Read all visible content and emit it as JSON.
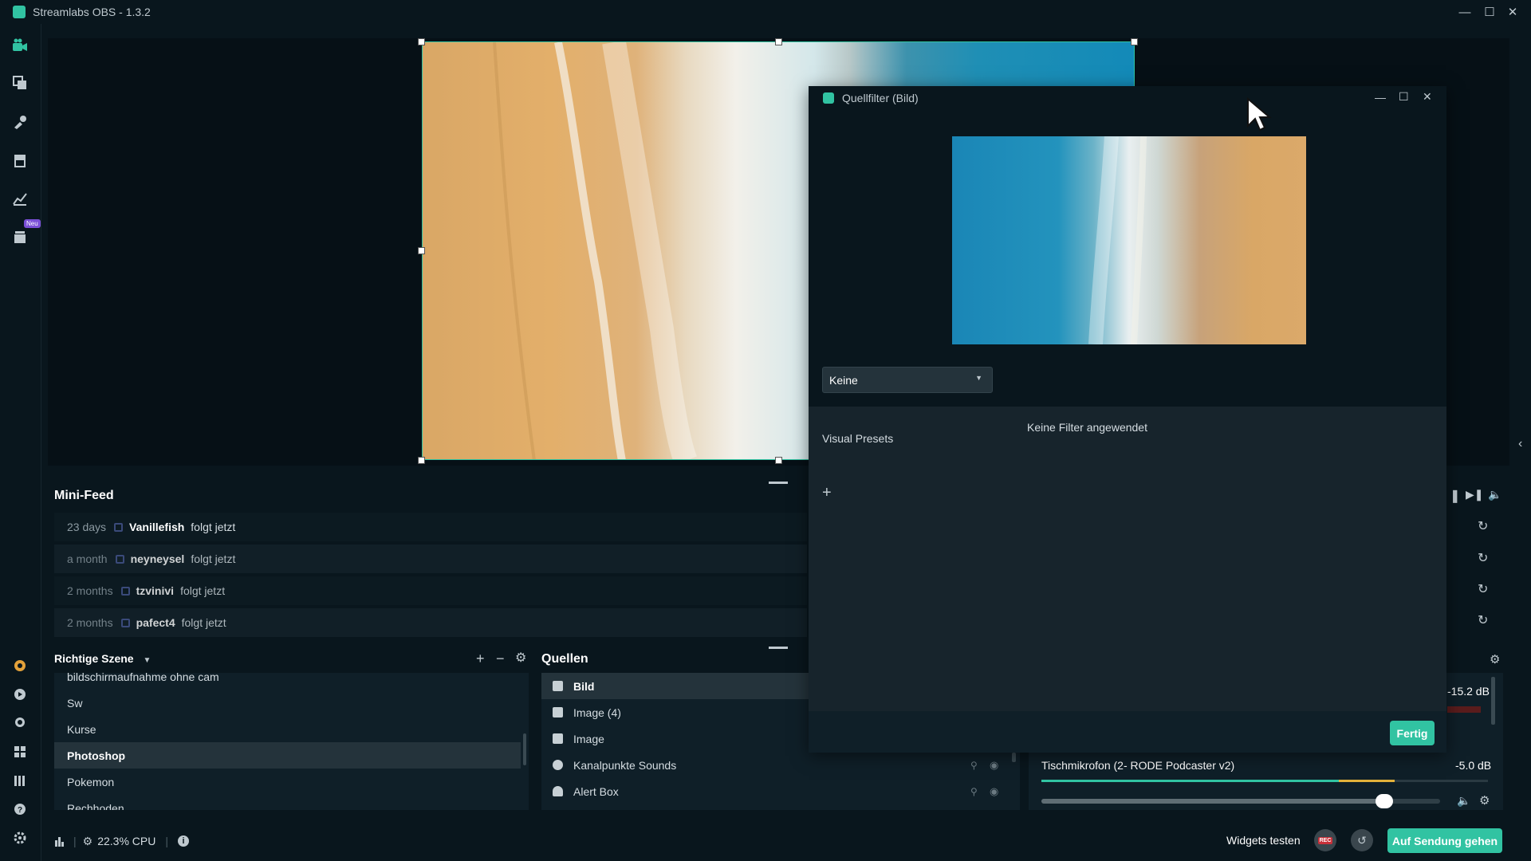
{
  "app": {
    "title": "Streamlabs OBS - 1.3.2"
  },
  "nav": {
    "badge_new": "Neu"
  },
  "minifeed": {
    "title": "Mini-Feed",
    "items": [
      {
        "time": "23 days",
        "user": "Vanillefish",
        "action": "folgt jetzt"
      },
      {
        "time": "a month",
        "user": "neyneysel",
        "action": "folgt jetzt"
      },
      {
        "time": "2 months",
        "user": "tzvinivi",
        "action": "folgt jetzt"
      },
      {
        "time": "2 months",
        "user": "pafect4",
        "action": "folgt jetzt"
      }
    ]
  },
  "scenes": {
    "title": "Richtige Szene",
    "items": [
      "bildschirmaufnahme ohne cam",
      "Sw",
      "Kurse",
      "Photoshop",
      "Pokemon",
      "Rechhoden"
    ],
    "active": "Photoshop"
  },
  "sources": {
    "title": "Quellen",
    "items": [
      "Bild",
      "Image (4)",
      "Image",
      "Kanalpunkte Sounds",
      "Alert Box"
    ],
    "active": "Bild"
  },
  "mixer": {
    "top_level": "-15.2 dB",
    "mic_name": "Tischmikrofon (2- RODE Podcaster v2)",
    "mic_level": "-5.0 dB",
    "mic_volume": 0.86
  },
  "footer": {
    "cpu": "22.3% CPU",
    "widgets_test": "Widgets testen",
    "rec": "REC",
    "go_live": "Auf Sendung gehen"
  },
  "dialog": {
    "title": "Quellfilter (Bild)",
    "no_filters": "Keine Filter angewendet",
    "visual_presets_label": "Visual Presets",
    "visual_presets_value": "Keine",
    "done_button": "Fertig"
  },
  "colors": {
    "accent": "#31c3a2",
    "background": "#09161d",
    "panel": "#17242c"
  }
}
